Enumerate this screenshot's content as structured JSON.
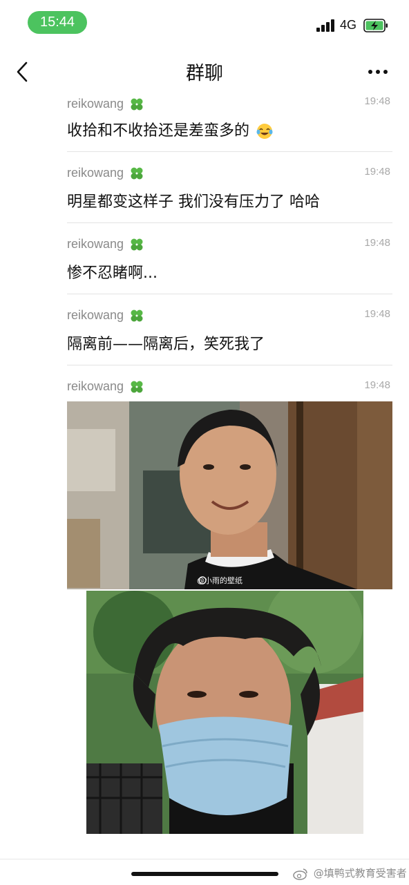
{
  "status_bar": {
    "time": "15:44",
    "network": "4G",
    "status_color": "#4cc35f"
  },
  "nav": {
    "title": "群聊"
  },
  "messages": [
    {
      "sender": "reikowang",
      "time": "19:48",
      "text": "收拾和不收拾还是差蛮多的",
      "emoji": "laughing-crying-emoji"
    },
    {
      "sender": "reikowang",
      "time": "19:48",
      "text": "明星都变这样子 我们没有压力了 哈哈"
    },
    {
      "sender": "reikowang",
      "time": "19:48",
      "text": "惨不忍睹啊..."
    },
    {
      "sender": "reikowang",
      "time": "19:48",
      "text": "隔离前——隔离后，笑死我了"
    },
    {
      "sender": "reikowang",
      "time": "19:48",
      "image": "before-after-photo",
      "image_watermark": "@小雨的壁纸"
    }
  ],
  "footer": {
    "watermark": "@填鸭式教育受害者"
  }
}
